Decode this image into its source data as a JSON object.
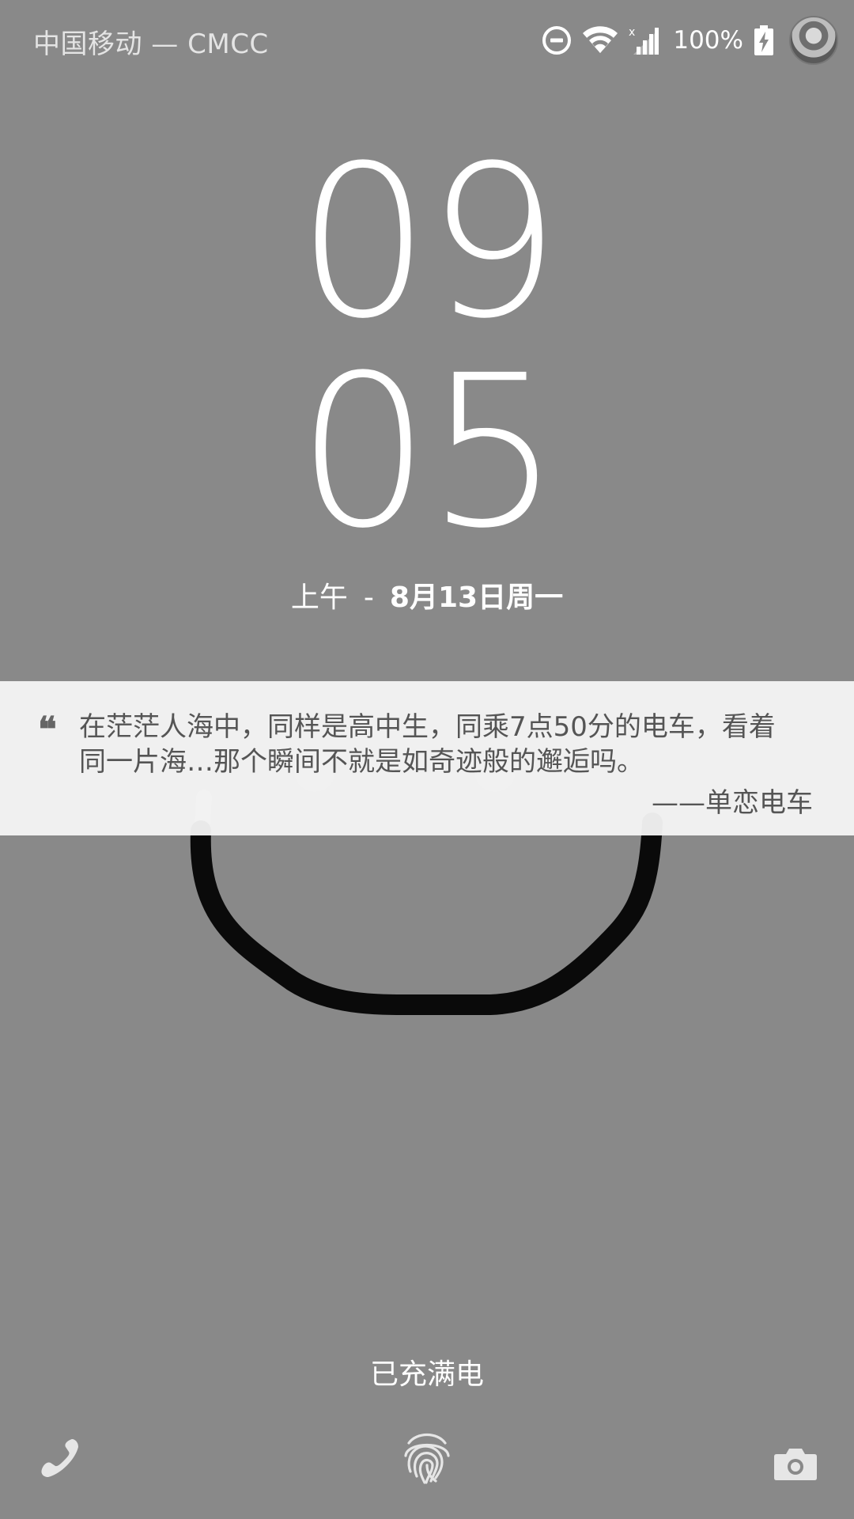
{
  "status_bar": {
    "carrier": "中国移动 — CMCC",
    "battery_percent": "100%",
    "icons": [
      "dnd-icon",
      "wifi-icon",
      "signal-icon",
      "battery-charging-icon",
      "avatar"
    ]
  },
  "clock": {
    "hour": "09",
    "minute": "05",
    "period": "上午",
    "separator": "-",
    "date": "8月13日周一"
  },
  "quote": {
    "text": "在茫茫人海中，同样是高中生，同乘7点50分的电车，看着同一片海…那个瞬间不就是如奇迹般的邂逅吗。",
    "source": "——单恋电车",
    "mark": "❝"
  },
  "charging": {
    "status": "已充满电"
  },
  "bottom_bar": {
    "icons": [
      "phone-icon",
      "fingerprint-icon",
      "camera-icon"
    ]
  },
  "colors": {
    "background": "#898989",
    "quote_card": "#f5f5f5",
    "text": "#ffffff"
  }
}
